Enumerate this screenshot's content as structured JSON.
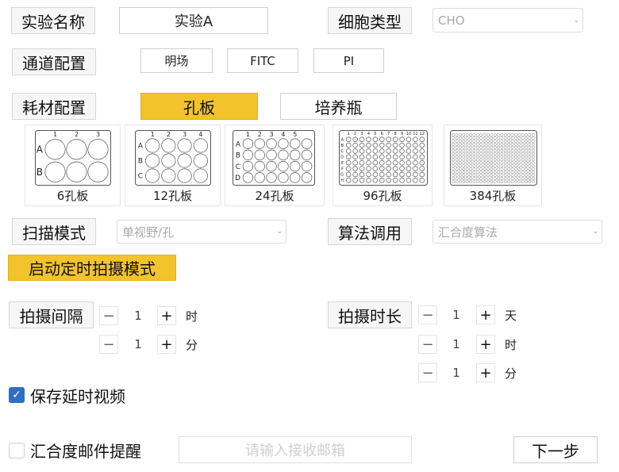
{
  "experiment": {
    "name_label": "实验名称",
    "name_value": "实验A",
    "cell_type_label": "细胞类型",
    "cell_type_value": "CHO"
  },
  "channels": {
    "label": "通道配置",
    "items": [
      "明场",
      "FITC",
      "PI"
    ]
  },
  "consumables": {
    "label": "耗材配置",
    "options": [
      "孔板",
      "培养瓶"
    ],
    "selected": "孔板"
  },
  "plates": [
    {
      "label": "6孔板",
      "rows": 2,
      "cols": 3,
      "row_labels": [
        "A",
        "B"
      ],
      "col_labels": [
        "1",
        "2",
        "3"
      ]
    },
    {
      "label": "12孔板",
      "rows": 3,
      "cols": 4,
      "row_labels": [
        "A",
        "B",
        "C"
      ],
      "col_labels": [
        "1",
        "2",
        "3",
        "4"
      ]
    },
    {
      "label": "24孔板",
      "rows": 4,
      "cols": 6,
      "row_labels": [
        "A",
        "B",
        "C",
        "D"
      ],
      "col_labels": [
        "1",
        "2",
        "3",
        "4",
        "5"
      ]
    },
    {
      "label": "96孔板",
      "rows": 8,
      "cols": 12,
      "row_labels": [
        "A",
        "B",
        "C",
        "D",
        "E",
        "F",
        "G",
        "H"
      ],
      "col_labels": [
        "1",
        "2",
        "3",
        "4",
        "5",
        "6",
        "7",
        "8",
        "9",
        "10",
        "11",
        "12"
      ]
    },
    {
      "label": "384孔板",
      "rows": 16,
      "cols": 24,
      "row_labels": [],
      "col_labels": []
    }
  ],
  "scan": {
    "label": "扫描模式",
    "value": "单视野/孔"
  },
  "algorithm": {
    "label": "算法调用",
    "value": "汇合度算法"
  },
  "timelapse_button": "启动定时拍摄模式",
  "interval": {
    "label": "拍摄间隔",
    "rows": [
      {
        "value": "1",
        "unit": "时"
      },
      {
        "value": "1",
        "unit": "分"
      }
    ]
  },
  "duration": {
    "label": "拍摄时长",
    "rows": [
      {
        "value": "1",
        "unit": "天"
      },
      {
        "value": "1",
        "unit": "时"
      },
      {
        "value": "1",
        "unit": "分"
      }
    ]
  },
  "stepper": {
    "minus": "−",
    "plus": "+"
  },
  "save_video": {
    "label": "保存延时视频",
    "checked": true
  },
  "email_alert": {
    "label": "汇合度邮件提醒",
    "checked": false,
    "placeholder": "请输入接收邮箱"
  },
  "next_button": "下一步",
  "icons": {
    "checkbox_check": "check-icon",
    "dropdown": "chevron-down-icon"
  },
  "colors": {
    "accent": "#f2c32a",
    "checkbox": "#2d6fc4"
  }
}
